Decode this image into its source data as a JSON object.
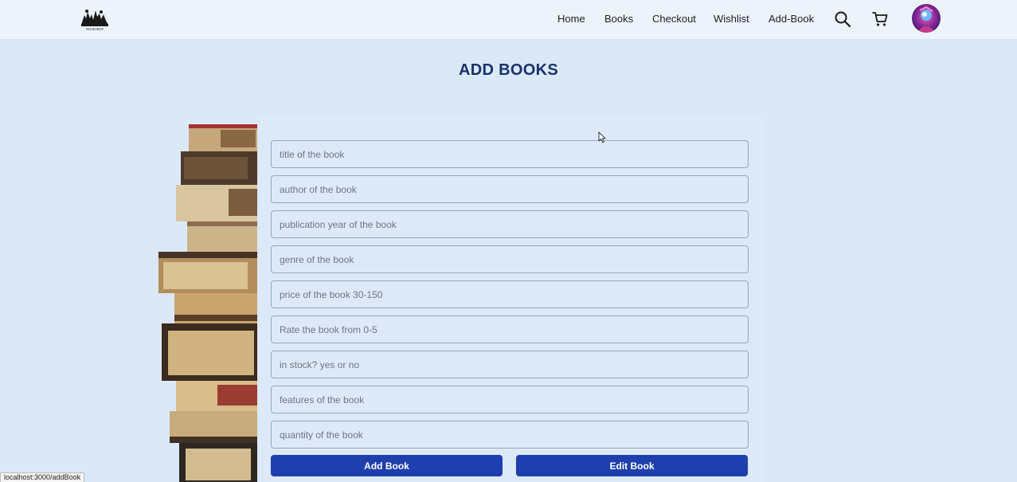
{
  "nav": {
    "logo_text": "BOOKSHOP",
    "links": [
      {
        "label": "Home"
      },
      {
        "label": "Books"
      },
      {
        "label": "Checkout"
      },
      {
        "label": "Wishlist"
      },
      {
        "label": "Add-Book"
      }
    ],
    "icons": [
      "search-icon",
      "cart-icon"
    ],
    "avatar": "user-avatar"
  },
  "page": {
    "title": "ADD BOOKS"
  },
  "form": {
    "fields": [
      {
        "placeholder": "title of the book",
        "value": ""
      },
      {
        "placeholder": "author of the book",
        "value": ""
      },
      {
        "placeholder": "publication year of the book",
        "value": ""
      },
      {
        "placeholder": "genre of the book",
        "value": ""
      },
      {
        "placeholder": "price of the book 30-150",
        "value": ""
      },
      {
        "placeholder": "Rate the book from 0-5",
        "value": ""
      },
      {
        "placeholder": "in stock? yes or no",
        "value": ""
      },
      {
        "placeholder": "features of the book",
        "value": ""
      },
      {
        "placeholder": "quantity of the book",
        "value": ""
      }
    ],
    "add_button": "Add Book",
    "edit_button": "Edit Book"
  },
  "status_bar": {
    "url": "localhost:3000/addBook"
  },
  "colors": {
    "background": "#dbe8f8",
    "navbar": "#edf3fb",
    "title": "#19336b",
    "button": "#1e3fad"
  }
}
